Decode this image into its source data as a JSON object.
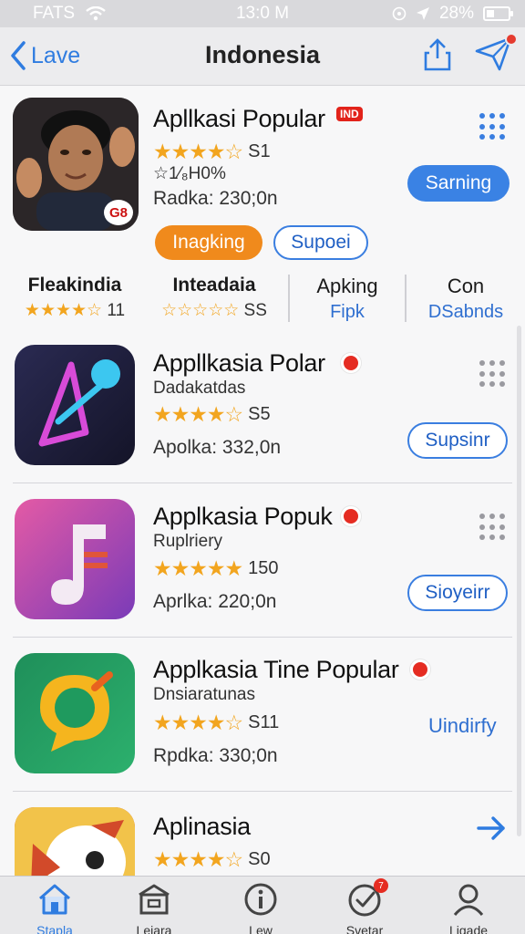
{
  "status_bar": {
    "carrier": "FATS",
    "time": "13:0 M",
    "battery": "28%"
  },
  "nav": {
    "back_label": "Lave",
    "title": "Indonesia"
  },
  "featured": {
    "title": "Apllkasi Popular",
    "badge": "IND",
    "rating_value": "S1",
    "sub_rating": "☆1⁄₈H0%",
    "meta": "Radka: 230;0n",
    "icon_label": "G8",
    "primary_button": "Sarning",
    "chip_orange": "Inagking",
    "chip_outline": "Supoei",
    "rating_stars": 4.5
  },
  "stats": [
    {
      "heading": "Fleakindia",
      "stars": "★★★★☆",
      "value": "11"
    },
    {
      "heading": "Inteadaia",
      "stars": "☆☆☆☆☆",
      "value": "SS"
    },
    {
      "heading": "Apking",
      "link": "Fipk"
    },
    {
      "heading": "Con",
      "link": "DSabnds"
    }
  ],
  "apps": [
    {
      "title": "Appllkasia Polar",
      "subtitle": "Dadakatdas",
      "rating_value": "S5",
      "meta": "Apolka: 332,0n",
      "button": "Supsinr",
      "rating_stars": 3.5
    },
    {
      "title": "Applkasia Popuk",
      "subtitle": "Ruplriery",
      "rating_value": "150",
      "meta": "Aprlka: 220;0n",
      "button": "Sioyeirr",
      "rating_stars": 5
    },
    {
      "title": "Applkasia Tine Popular",
      "subtitle": "Dnsiaratunas",
      "rating_value": "S11",
      "meta": "Rpdka: 330;0n",
      "link": "Uindirfy",
      "rating_stars": 4.5
    },
    {
      "title": "Aplinasia",
      "rating_value": "S0",
      "rating_stars": 3.5
    }
  ],
  "tabs": [
    {
      "label": "Stapla",
      "icon": "home-icon",
      "active": true
    },
    {
      "label": "Leiara",
      "icon": "store-icon"
    },
    {
      "label": "Lew",
      "icon": "info-icon"
    },
    {
      "label": "Svetar",
      "icon": "check-badge-icon",
      "badge": "7"
    },
    {
      "label": "Ligade",
      "icon": "profile-icon"
    }
  ],
  "colors": {
    "accent": "#2f7ce0",
    "star": "#f2a51f",
    "orange": "#f08a1c",
    "badge_red": "#e52c22"
  }
}
